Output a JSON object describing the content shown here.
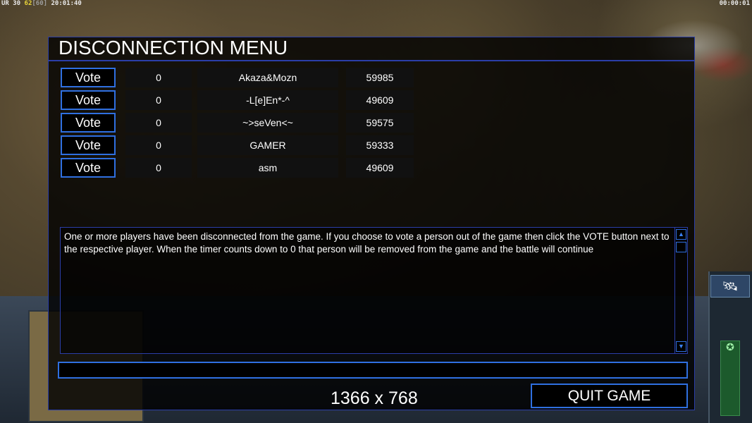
{
  "hud": {
    "fps_label": "UR",
    "fps_a": "30",
    "fps_b": "62",
    "fps_c": "[60]",
    "clock": "20:01:40",
    "game_timer": "00:00:01"
  },
  "dialog": {
    "title": "DISCONNECTION MENU",
    "players": [
      {
        "vote_label": "Vote",
        "votes": "0",
        "name": "Akaza&Mozn",
        "ping": "59985"
      },
      {
        "vote_label": "Vote",
        "votes": "0",
        "name": "-L[e]En*-^",
        "ping": "49609"
      },
      {
        "vote_label": "Vote",
        "votes": "0",
        "name": "~>seVen<~",
        "ping": "59575"
      },
      {
        "vote_label": "Vote",
        "votes": "0",
        "name": "GAMER",
        "ping": "59333"
      },
      {
        "vote_label": "Vote",
        "votes": "0",
        "name": "asm",
        "ping": "49609"
      }
    ],
    "message": "One or more players have been disconnected from the game. If you choose to vote a person out of the game then click the VOTE button next to the respective player. When the timer counts down to 0 that person will be removed from the game and the battle will continue",
    "resolution": "1366 x 768",
    "quit_label": "QUIT GAME"
  },
  "colors": {
    "accent_border": "#2f6fe0",
    "dialog_bg": "#000000",
    "hud_yellow": "#e8d43a"
  }
}
